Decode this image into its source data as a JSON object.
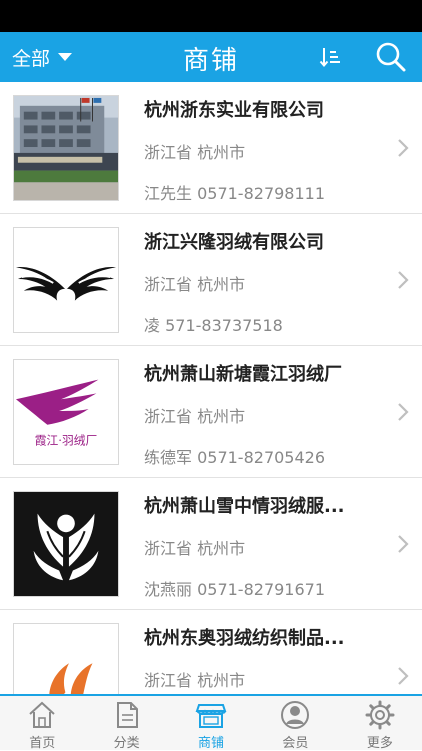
{
  "header": {
    "filter_label": "全部",
    "title": "商铺",
    "sort_icon": "sort-icon",
    "search_icon": "search-icon"
  },
  "shops": [
    {
      "name": "杭州浙东实业有限公司",
      "region": "浙江省 杭州市",
      "contact": "江先生 0571-82798111",
      "logo": "building-photo"
    },
    {
      "name": "浙江兴隆羽绒有限公司",
      "region": "浙江省 杭州市",
      "contact": "凌 571-83737518",
      "logo": "wings-logo"
    },
    {
      "name": "杭州萧山新塘霞江羽绒厂",
      "region": "浙江省 杭州市",
      "contact": "练德军 0571-82705426",
      "logo": "purple-wing-logo",
      "logo_text": "霞江·羽绒厂"
    },
    {
      "name": "杭州萧山雪中情羽绒服...",
      "region": "浙江省 杭州市",
      "contact": "沈燕丽 0571-82791671",
      "logo": "white-wings-logo"
    },
    {
      "name": "杭州东奥羽绒纺织制品...",
      "region": "浙江省 杭州市",
      "contact": "",
      "logo": "orange-flame-logo"
    }
  ],
  "tabbar": {
    "tabs": [
      {
        "label": "首页",
        "icon": "home-icon"
      },
      {
        "label": "分类",
        "icon": "category-icon"
      },
      {
        "label": "商铺",
        "icon": "shop-icon",
        "active": true
      },
      {
        "label": "会员",
        "icon": "member-icon"
      },
      {
        "label": "更多",
        "icon": "more-gear-icon"
      }
    ]
  },
  "colors": {
    "primary": "#1aa3e4",
    "status_bar": "#000000",
    "title_text": "#222222",
    "meta_text": "#888888",
    "logo_purple": "#9b1f86"
  }
}
